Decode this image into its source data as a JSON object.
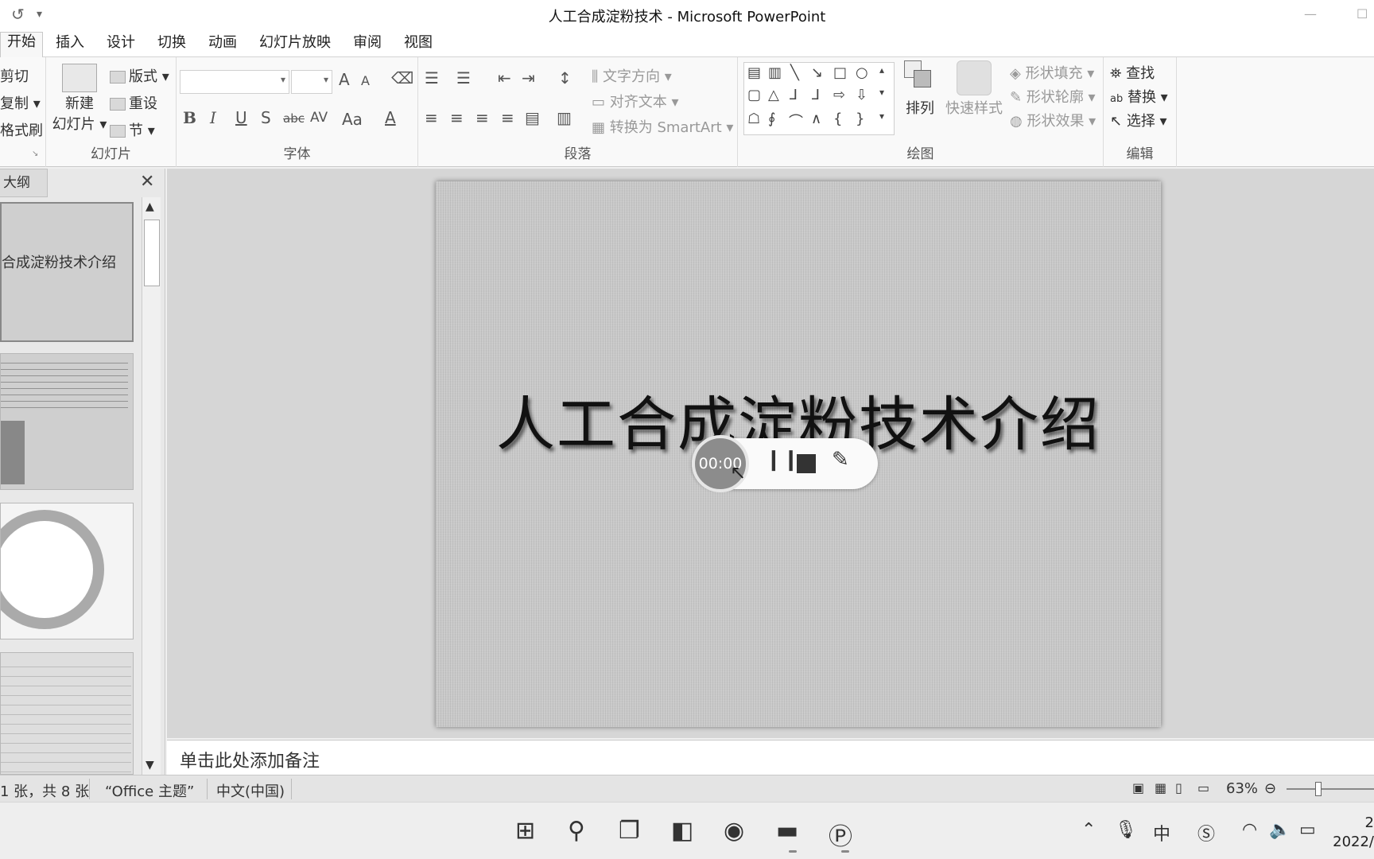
{
  "window": {
    "title": "人工合成淀粉技术 - Microsoft PowerPoint",
    "qat_undo": "↺",
    "qat_more": "▾"
  },
  "tabs": [
    "开始",
    "插入",
    "设计",
    "切换",
    "动画",
    "幻灯片放映",
    "审阅",
    "视图"
  ],
  "ribbon": {
    "clipboard": {
      "cut": "剪切",
      "copy": "复制 ▾",
      "format_painter": "格式刷"
    },
    "slides": {
      "new_slide_1": "新建",
      "new_slide_2": "幻灯片 ▾",
      "layout": "版式 ▾",
      "reset": "重设",
      "section": "节 ▾",
      "label": "幻灯片"
    },
    "font": {
      "label": "字体",
      "bold": "B",
      "italic": "I",
      "underline": "U",
      "shadow": "S",
      "strike": "abc",
      "spacing": "AV",
      "case": "Aa",
      "color": "A",
      "grow": "A",
      "shrink": "A"
    },
    "paragraph": {
      "label": "段落",
      "text_direction": "文字方向 ▾",
      "align_text": "对齐文本 ▾",
      "smartart": "转换为 SmartArt ▾"
    },
    "drawing": {
      "label": "绘图",
      "arrange": "排列",
      "quick_styles": "快速样式",
      "shape_fill": "形状填充 ▾",
      "shape_outline": "形状轮廓 ▾",
      "shape_effects": "形状效果 ▾"
    },
    "editing": {
      "label": "编辑",
      "find": "查找",
      "replace": "替换 ▾",
      "select": "选择 ▾"
    }
  },
  "left_pane": {
    "tab": "大纲",
    "close": "✕",
    "thumb1_title": "合成淀粉技术介绍"
  },
  "slide": {
    "title": "人工合成淀粉技术介绍"
  },
  "recorder": {
    "time": "00:00",
    "pause": "❙❙",
    "pen": "✎"
  },
  "notes": {
    "placeholder": "单击此处添加备注"
  },
  "status": {
    "slide_count": "1 张，共 8 张",
    "theme": "“Office 主题”",
    "language": "中文(中国)",
    "zoom": "63%"
  },
  "taskbar": {
    "clock_time": "2",
    "clock_date": "2022/"
  }
}
